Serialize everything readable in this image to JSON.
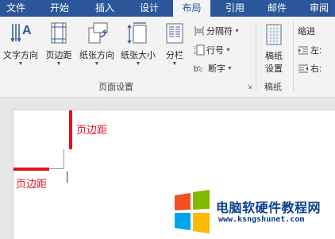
{
  "tabs": [
    {
      "label": "文件"
    },
    {
      "label": "开始"
    },
    {
      "label": "插入"
    },
    {
      "label": "设计"
    },
    {
      "label": "布局"
    },
    {
      "label": "引用"
    },
    {
      "label": "邮件"
    },
    {
      "label": "审阅"
    }
  ],
  "ribbon": {
    "text_direction": "文字方向",
    "margins": "页边距",
    "orientation": "纸张方向",
    "size": "纸张大小",
    "columns": "分栏",
    "breaks": "分隔符",
    "line_numbers": "行号",
    "hyphenation": "断字",
    "page_setup_group": "页面设置",
    "manuscript_line1": "稿纸",
    "manuscript_line2": "设置",
    "manuscript_group": "稿纸",
    "indent": "缩进",
    "indent_left": "左:",
    "indent_right": "右:"
  },
  "document": {
    "annotation_top": "页边距",
    "annotation_left": "页边距"
  },
  "watermark": {
    "text": "电脑软硬件教程网",
    "url": "www.ksngshunet.com"
  },
  "colors": {
    "tab_bar": "#2b579a",
    "ribbon_bg": "#f3f3f3",
    "margin_marker": "#e0141e"
  },
  "icons": [
    "text-direction-icon",
    "margins-icon",
    "orientation-icon",
    "size-icon",
    "columns-icon",
    "breaks-icon",
    "line-numbers-icon",
    "hyphenation-icon",
    "manuscript-icon",
    "indent-left-icon",
    "indent-right-icon",
    "dialog-launcher-icon"
  ]
}
